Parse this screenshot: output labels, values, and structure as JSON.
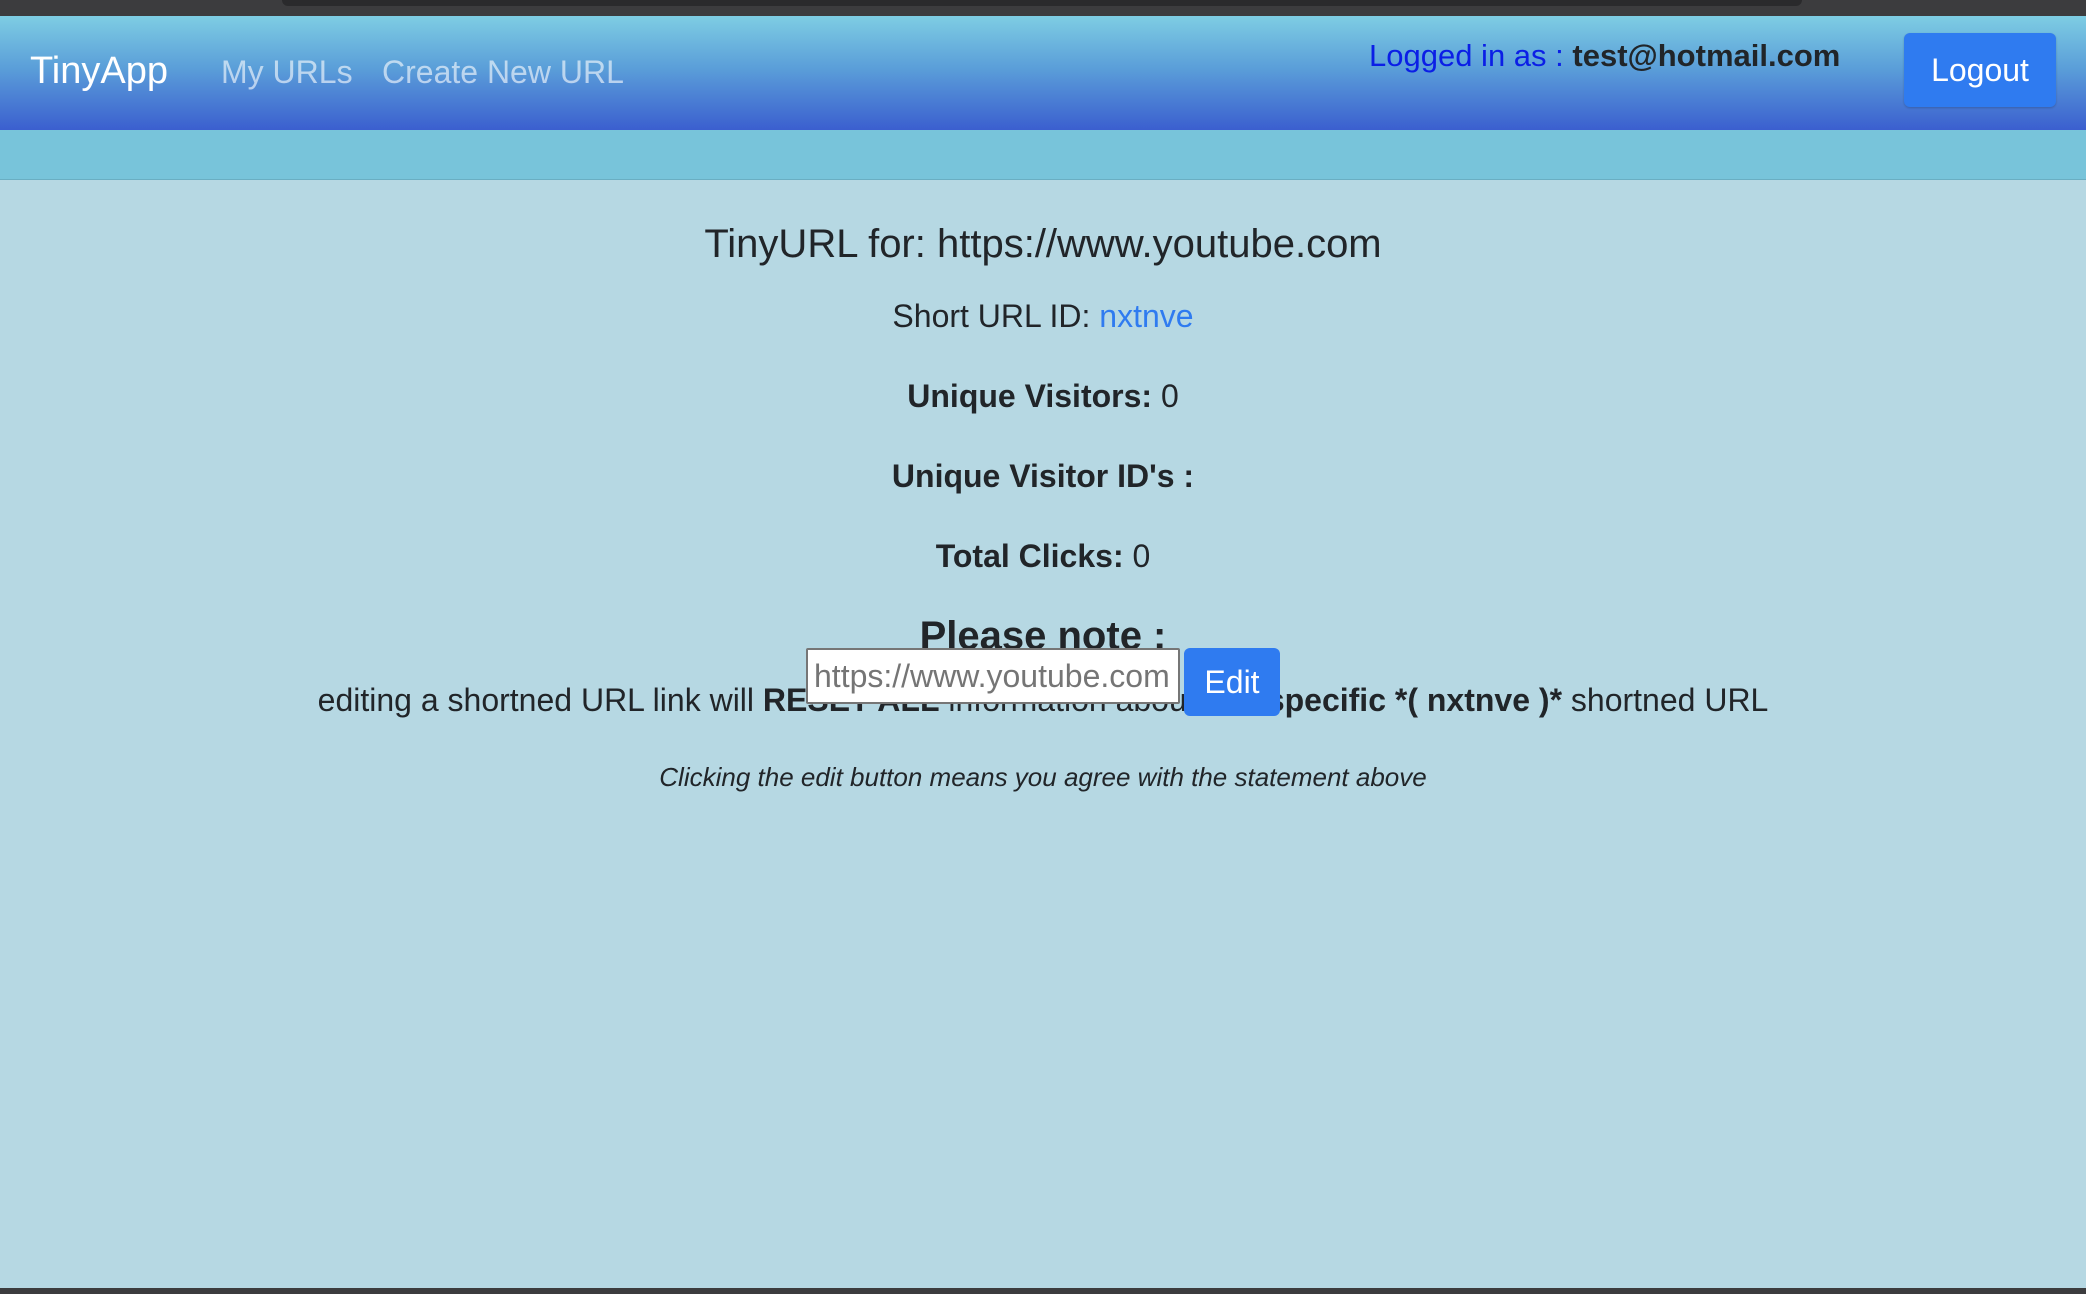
{
  "navbar": {
    "brand": "TinyApp",
    "links": {
      "my_urls": "My URLs",
      "create_new_url": "Create New URL"
    },
    "logged_in_label": "Logged in as : ",
    "logged_in_email": "test@hotmail.com",
    "logout_label": "Logout"
  },
  "main": {
    "title": "TinyURL for: https://www.youtube.com",
    "short_id_label": "Short URL ID: ",
    "short_id_value": "nxtnve",
    "unique_visitors_label": "Unique Visitors:",
    "unique_visitors_value": " 0",
    "unique_visitor_ids_label": "Unique Visitor ID's :",
    "total_clicks_label": "Total Clicks:",
    "total_clicks_value": " 0",
    "note_heading": "Please note :",
    "note": {
      "part1": "editing a shortned URL link will ",
      "reset_all": "RESET ALL",
      "part2": " information about that ",
      "specific": "specific *( nxtnve )*",
      "part3": " shortned URL"
    },
    "agree_text": "Clicking the edit button means you agree with the statement above",
    "edit_form": {
      "placeholder": "https://www.youtube.com",
      "button_label": "Edit"
    }
  },
  "colors": {
    "page_background": "#b6d8e3",
    "subbar": "#78c4da",
    "navbar_gradient_top": "#7ecde3",
    "navbar_gradient_bottom": "#3b5fcf",
    "primary_button": "#2f7bf0",
    "logged_in_text": "#0b1ee6",
    "link": "#2f7bf0"
  }
}
